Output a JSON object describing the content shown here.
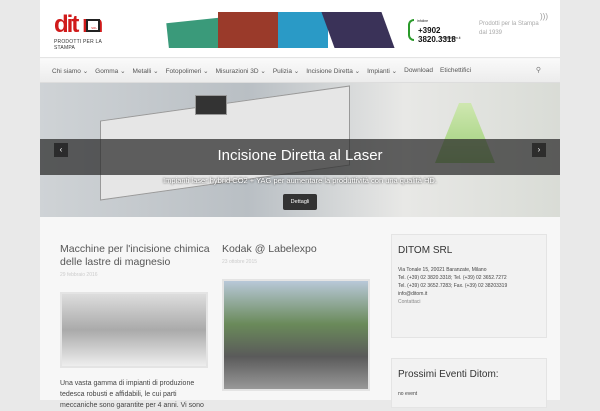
{
  "header": {
    "logo_text": "dit m",
    "logo_srl": "SRL",
    "logo_sub": "PRODOTTI PER LA STAMPA",
    "phone_label": "infoline",
    "phone": "+3902 3820.3318",
    "phone_email": "info@ditom.it",
    "tagline_1": "Prodotti per la Stampa",
    "tagline_2": "dal 1939",
    "rss_icon": "rss-icon"
  },
  "nav": {
    "items": [
      "Chi siamo ⌄",
      "Gomma ⌄",
      "Metalli ⌄",
      "Fotopolimeri ⌄",
      "Misurazioni 3D ⌄",
      "Pulizia ⌄",
      "Incisione Diretta ⌄",
      "Impianti ⌄",
      "Download",
      "Etichettifici"
    ],
    "search_icon": "⚲"
  },
  "slider": {
    "title": "Incisione Diretta al Laser",
    "subtitle": "Impianti laser hybrid CO2 + YAG per aumentare la produttività con una qualità HD.",
    "button": "Dettagli",
    "prev": "‹",
    "next": "›"
  },
  "posts": [
    {
      "title": "Macchine per l'incisione chimica delle lastre di magnesio",
      "date": "29 febbraio 2016",
      "excerpt": "Una vasta gamma di impianti di produzione tedesca robusti e affidabili, le cui parti meccaniche sono garantite per 4 anni. Vi sono"
    },
    {
      "title": "Kodak @ Labelexpo",
      "date": "23 ottobre 2015"
    }
  ],
  "widget_contact": {
    "title": "DITOM SRL",
    "lines": [
      "Via Tonale 15, 20021 Baranzate, Milano",
      "Tel. (+39) 02 3820.3318; Tel. (+39) 02 3652.7272",
      "Tel. (+39) 02 3652.7283; Fax. (+39) 02 38203319",
      "info@ditom.it"
    ],
    "link": "Contattaci"
  },
  "widget_events": {
    "title": "Prossimi Eventi Ditom:",
    "text": "no event"
  }
}
